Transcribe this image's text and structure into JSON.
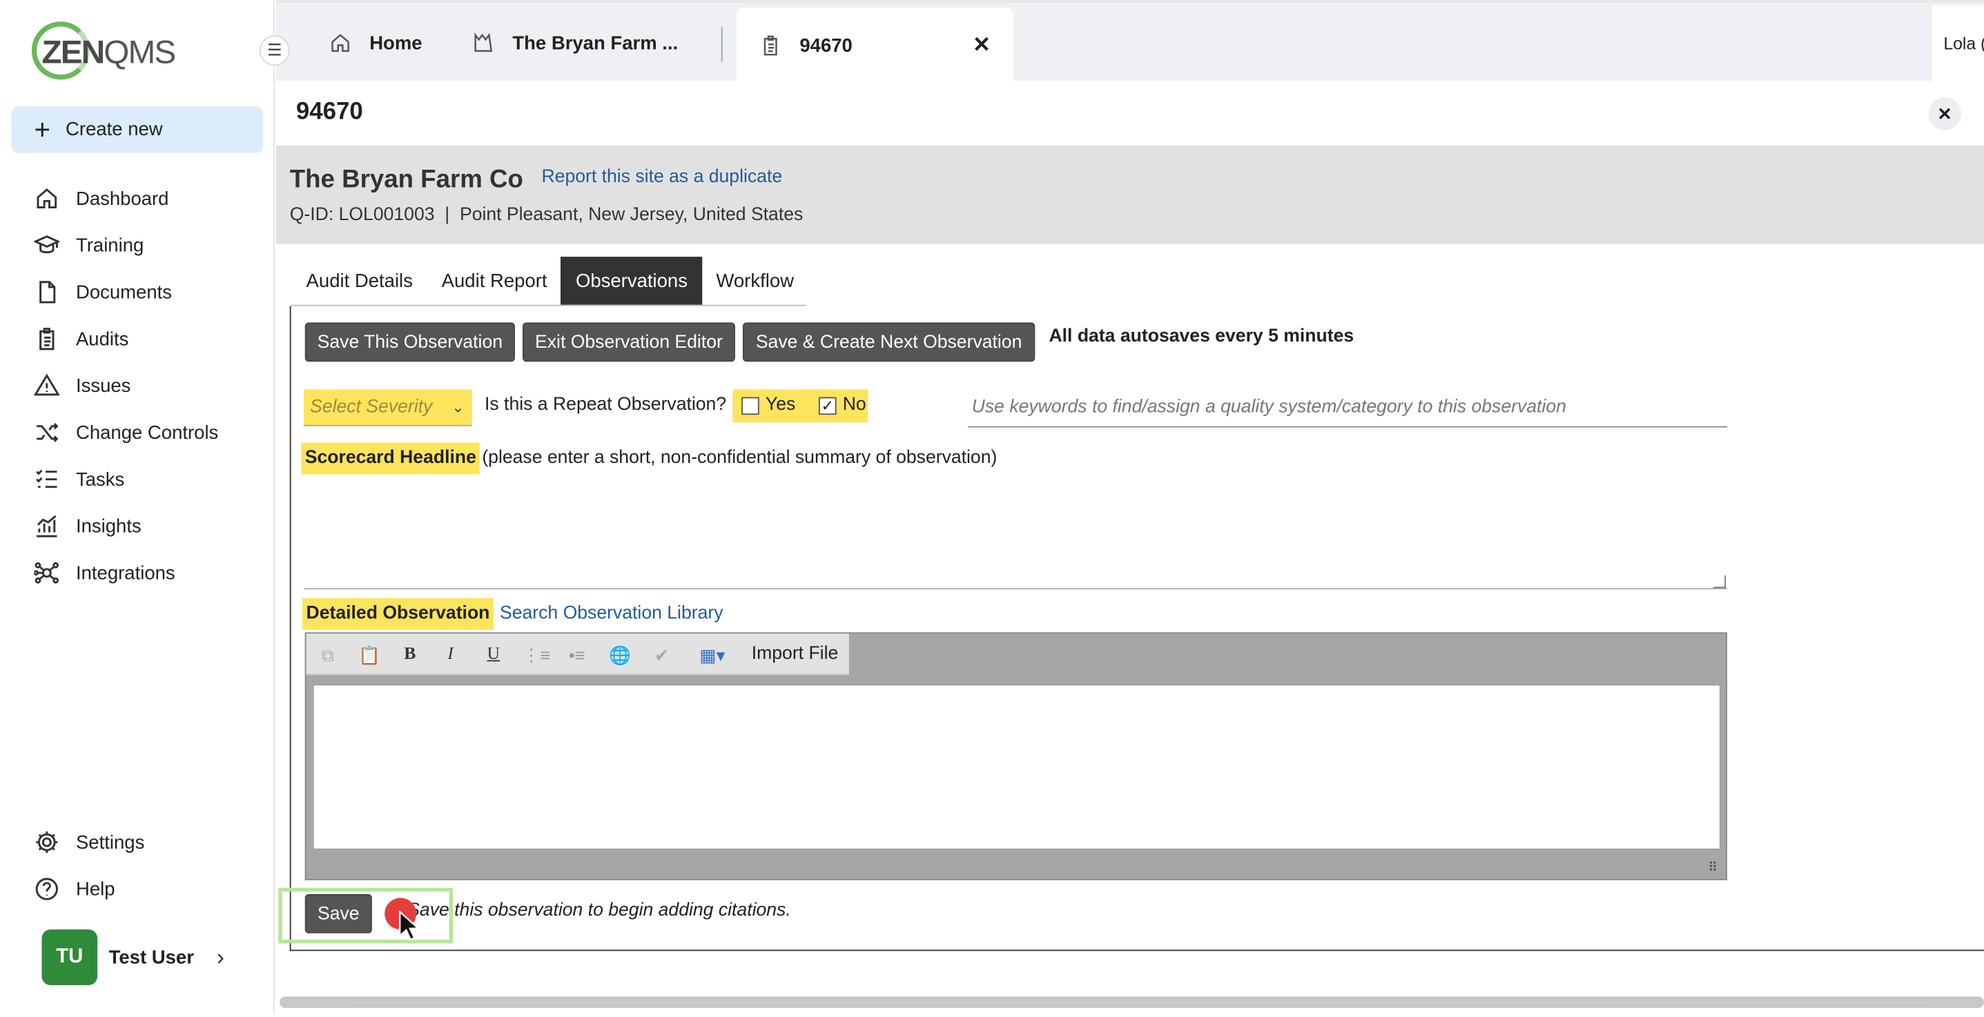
{
  "sidebar": {
    "create_new": "Create new",
    "items": [
      {
        "label": "Dashboard",
        "icon": "home-icon"
      },
      {
        "label": "Training",
        "icon": "graduation-cap-icon"
      },
      {
        "label": "Documents",
        "icon": "document-icon"
      },
      {
        "label": "Audits",
        "icon": "clipboard-icon"
      },
      {
        "label": "Issues",
        "icon": "warning-triangle-icon"
      },
      {
        "label": "Change Controls",
        "icon": "shuffle-icon"
      },
      {
        "label": "Tasks",
        "icon": "checklist-icon"
      },
      {
        "label": "Insights",
        "icon": "chart-icon"
      },
      {
        "label": "Integrations",
        "icon": "network-icon"
      }
    ],
    "bottom_items": [
      {
        "label": "Settings",
        "icon": "gear-icon"
      },
      {
        "label": "Help",
        "icon": "help-icon"
      }
    ],
    "user": {
      "initials": "TU",
      "name": "Test User"
    }
  },
  "tabs": [
    {
      "label": "Home",
      "icon": "home-icon"
    },
    {
      "label": "The Bryan Farm ...",
      "icon": "factory-icon"
    },
    {
      "label": "94670",
      "icon": "clipboard-icon",
      "active": true
    }
  ],
  "account": "Lola (THIS IS A ZENQMS TEST ACCOUNT)",
  "record": {
    "title": "94670",
    "site_name": "The Bryan Farm Co",
    "duplicate_link": "Report this site as a duplicate",
    "meta": "Q-ID: LOL001003  |  Point Pleasant, New Jersey, United States"
  },
  "subtabs": [
    "Audit Details",
    "Audit Report",
    "Observations",
    "Workflow"
  ],
  "active_subtab": "Observations",
  "actions": {
    "save_observation": "Save This Observation",
    "exit_editor": "Exit Observation Editor",
    "save_create_next": "Save & Create Next Observation",
    "autosave_note": "All data autosaves every 5 minutes"
  },
  "form": {
    "severity_placeholder": "Select Severity",
    "repeat_question": "Is this a Repeat Observation?",
    "yes_label": "Yes",
    "no_label": "No",
    "yes_checked": false,
    "no_checked": true,
    "keywords_placeholder": "Use keywords to find/assign a quality system/category to this observation",
    "headline_label": "Scorecard Headline",
    "headline_hint": "(please enter a short, non-confidential summary of observation)",
    "detail_label": "Detailed Observation",
    "library_link": "Search Observation Library",
    "import_file": "Import File",
    "save_button": "Save",
    "citations_note": "Save this observation to begin adding citations."
  },
  "colors": {
    "highlight": "#fde45d",
    "active_tab": "#333333",
    "link": "#1f5c99",
    "brand_green": "#69b85a",
    "click_marker": "#e53c3c"
  }
}
